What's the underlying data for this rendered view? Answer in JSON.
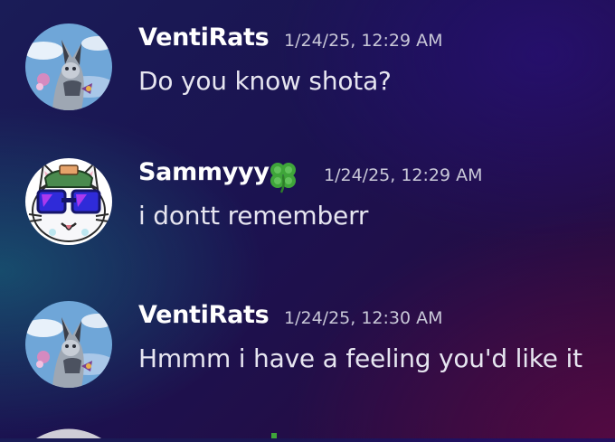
{
  "messages": [
    {
      "username": "VentiRats",
      "timestamp": "1/24/25, 12:29 AM",
      "text": "Do you know shota?",
      "avatar": "cat-character-avatar-icon"
    },
    {
      "username": "Sammyyy",
      "username_emoji": "four-leaf-clover-icon",
      "timestamp": "1/24/25, 12:29 AM",
      "text": "i dontt rememberr",
      "avatar": "white-cat-goggles-avatar-icon"
    },
    {
      "username": "VentiRats",
      "timestamp": "1/24/25, 12:30 AM",
      "text": "Hmmm i have a feeling you'd like it",
      "avatar": "cat-character-avatar-icon"
    }
  ],
  "colors": {
    "username": "#ffffff",
    "timestamp": "#c9c8d8",
    "message_text": "#e6e5f0",
    "clover": "#3fa53a"
  }
}
